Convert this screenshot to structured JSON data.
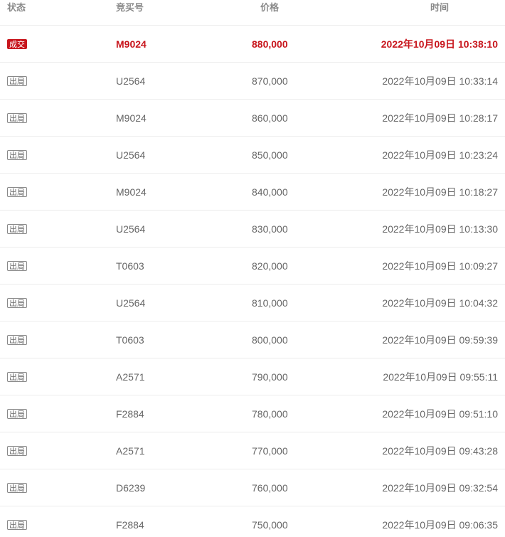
{
  "columns": {
    "status": "状态",
    "bidder": "竞买号",
    "price": "价格",
    "time": "时间"
  },
  "colors": {
    "winner_red": "#c8161d",
    "text_gray": "#666666",
    "header_gray": "#8a8a8a"
  },
  "rows": [
    {
      "status": "成交",
      "bidder": "M9024",
      "price": "880,000",
      "time": "2022年10月09日 10:38:10",
      "winner": true
    },
    {
      "status": "出局",
      "bidder": "U2564",
      "price": "870,000",
      "time": "2022年10月09日 10:33:14",
      "winner": false
    },
    {
      "status": "出局",
      "bidder": "M9024",
      "price": "860,000",
      "time": "2022年10月09日 10:28:17",
      "winner": false
    },
    {
      "status": "出局",
      "bidder": "U2564",
      "price": "850,000",
      "time": "2022年10月09日 10:23:24",
      "winner": false
    },
    {
      "status": "出局",
      "bidder": "M9024",
      "price": "840,000",
      "time": "2022年10月09日 10:18:27",
      "winner": false
    },
    {
      "status": "出局",
      "bidder": "U2564",
      "price": "830,000",
      "time": "2022年10月09日 10:13:30",
      "winner": false
    },
    {
      "status": "出局",
      "bidder": "T0603",
      "price": "820,000",
      "time": "2022年10月09日 10:09:27",
      "winner": false
    },
    {
      "status": "出局",
      "bidder": "U2564",
      "price": "810,000",
      "time": "2022年10月09日 10:04:32",
      "winner": false
    },
    {
      "status": "出局",
      "bidder": "T0603",
      "price": "800,000",
      "time": "2022年10月09日 09:59:39",
      "winner": false
    },
    {
      "status": "出局",
      "bidder": "A2571",
      "price": "790,000",
      "time": "2022年10月09日 09:55:11",
      "winner": false
    },
    {
      "status": "出局",
      "bidder": "F2884",
      "price": "780,000",
      "time": "2022年10月09日 09:51:10",
      "winner": false
    },
    {
      "status": "出局",
      "bidder": "A2571",
      "price": "770,000",
      "time": "2022年10月09日 09:43:28",
      "winner": false
    },
    {
      "status": "出局",
      "bidder": "D6239",
      "price": "760,000",
      "time": "2022年10月09日 09:32:54",
      "winner": false
    },
    {
      "status": "出局",
      "bidder": "F2884",
      "price": "750,000",
      "time": "2022年10月09日 09:06:35",
      "winner": false
    }
  ]
}
